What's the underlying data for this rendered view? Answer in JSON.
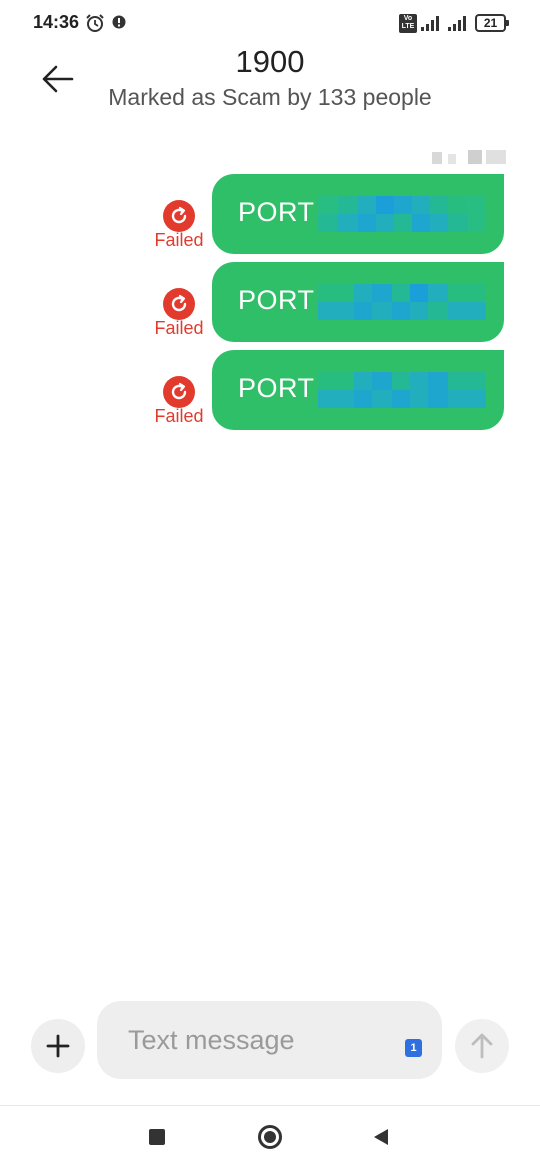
{
  "status_bar": {
    "time": "14:36",
    "volte_label": "Vo LTE",
    "battery_level": "21",
    "icons": [
      "alarm-icon",
      "notification-icon",
      "volte-icon",
      "signal-icon",
      "signal-icon",
      "battery-icon"
    ]
  },
  "header": {
    "title": "1900",
    "subtitle": "Marked as Scam by 133 people",
    "back_icon": "arrow-left-icon"
  },
  "messages": [
    {
      "text": "PORT",
      "status": "Failed"
    },
    {
      "text": "PORT",
      "status": "Failed"
    },
    {
      "text": "PORT",
      "status": "Failed"
    }
  ],
  "composer": {
    "placeholder": "Text message",
    "sim_slot": "1",
    "add_icon": "plus-icon",
    "send_icon": "arrow-up-icon"
  },
  "nav_bar": {
    "icons": [
      "square-icon",
      "circle-icon",
      "triangle-back-icon"
    ]
  },
  "colors": {
    "bubble": "#2fbf69",
    "failed": "#e23b2e",
    "sim_badge": "#2f6fe0",
    "pixelation": [
      "#27bd80",
      "#25b894",
      "#22aebc",
      "#1ea6cf",
      "#1c9fd8",
      "#29bd76"
    ]
  }
}
